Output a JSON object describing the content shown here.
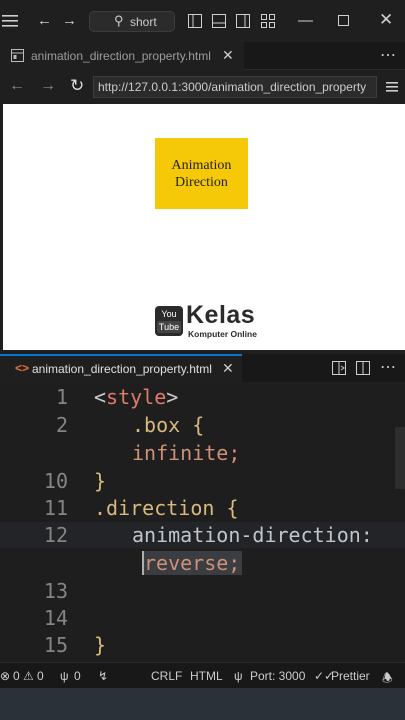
{
  "titlebar": {
    "search_label": "short",
    "icons": [
      "menu-icon",
      "back-arrow-icon",
      "forward-arrow-icon",
      "search-icon",
      "toggle-primary-sidebar-icon",
      "toggle-panel-icon",
      "toggle-secondary-sidebar-icon",
      "customize-layout-icon",
      "minimize-icon",
      "maximize-icon",
      "close-icon"
    ]
  },
  "browser_tab": {
    "label": "animation_direction_property.html"
  },
  "addressbar": {
    "url": "http://127.0.0.1:3000/animation_direction_property"
  },
  "viewport": {
    "box_line1": "Animation",
    "box_line2": "Direction",
    "logo_badge_top": "You",
    "logo_badge_bottom": "Tube",
    "logo_title": "Kelas",
    "logo_subtitle": "Komputer Online"
  },
  "editor_tab": {
    "label": "animation_direction_property.html"
  },
  "code": {
    "lines": [
      {
        "num": "1",
        "text": "<style>"
      },
      {
        "num": "2",
        "text": ".box {"
      },
      {
        "num": "",
        "text": "infinite;"
      },
      {
        "num": "10",
        "text": "}"
      },
      {
        "num": "11",
        "text": ".direction {"
      },
      {
        "num": "12",
        "text": "animation-direction:"
      },
      {
        "num": "",
        "text": "reverse;"
      },
      {
        "num": "13",
        "text": ""
      },
      {
        "num": "14",
        "text": ""
      },
      {
        "num": "15",
        "text": "}"
      }
    ]
  },
  "statusbar": {
    "errors": "0",
    "warnings": "0",
    "ports_count": "0",
    "eol": "CRLF",
    "language": "HTML",
    "port": "Port: 3000",
    "formatter": "Prettier"
  },
  "colors": {
    "accent": "#0078d4",
    "box_fill": "#f6c908",
    "tag": "#e07a6a",
    "selector": "#d7ba7d",
    "value": "#ce9178"
  }
}
